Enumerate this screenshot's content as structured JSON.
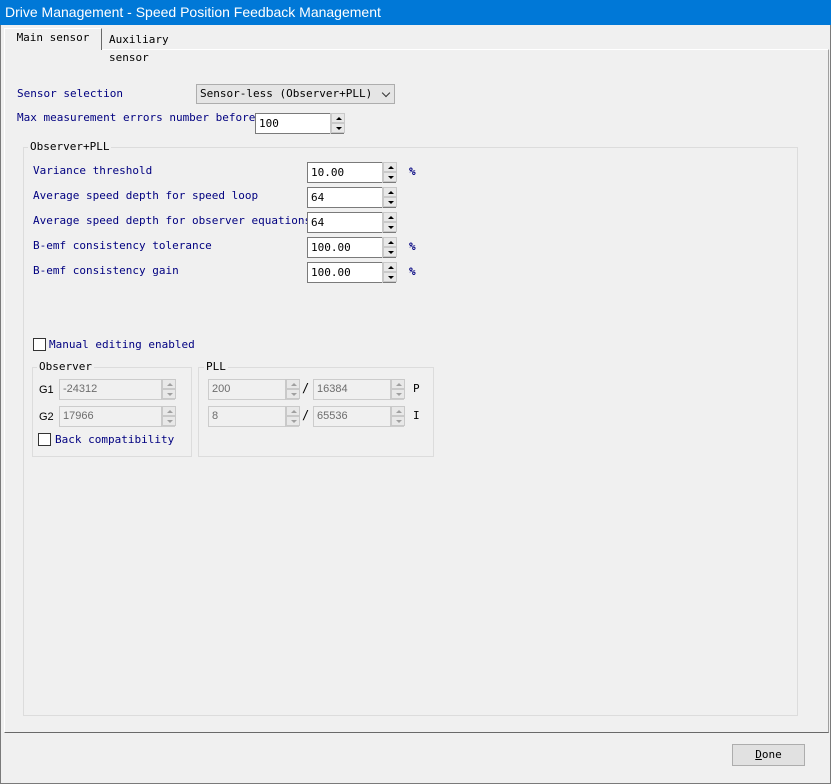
{
  "window": {
    "title": "Drive Management - Speed Position Feedback Management"
  },
  "tabs": [
    {
      "label": "Main sensor",
      "active": true
    },
    {
      "label": "Auxiliary sensor",
      "active": false
    }
  ],
  "main": {
    "sensor_selection": {
      "label": "Sensor selection",
      "value": "Sensor-less (Observer+PLL)"
    },
    "max_errors": {
      "label": "Max measurement errors number before",
      "value": "100"
    }
  },
  "observer_pll": {
    "title": "Observer+PLL",
    "rows": [
      {
        "label": "Variance threshold",
        "value": "10.00",
        "unit": "%"
      },
      {
        "label": "Average speed depth for speed loop",
        "value": "64",
        "unit": ""
      },
      {
        "label": "Average speed depth for observer equations",
        "value": "64",
        "unit": ""
      },
      {
        "label": "B-emf consistency tolerance",
        "value": "100.00",
        "unit": "%"
      },
      {
        "label": "B-emf consistency gain",
        "value": "100.00",
        "unit": "%"
      }
    ],
    "manual_editing": {
      "label": "Manual editing enabled",
      "checked": false
    }
  },
  "observer": {
    "title": "Observer",
    "g1": {
      "label": "G1",
      "value": "-24312"
    },
    "g2": {
      "label": "G2",
      "value": "17966"
    },
    "back_compat": {
      "label": "Back compatibility",
      "checked": false
    }
  },
  "pll": {
    "title": "PLL",
    "p": {
      "num": "200",
      "den": "16384",
      "label": "P"
    },
    "i": {
      "num": "8",
      "den": "65536",
      "label": "I"
    },
    "separator": "/"
  },
  "footer": {
    "done_label": "Done",
    "done_mnemonic": "D",
    "done_rest": "one"
  },
  "colors": {
    "titlebar": "#0078d7",
    "label_text": "#000080",
    "background": "#f0f0f0"
  }
}
